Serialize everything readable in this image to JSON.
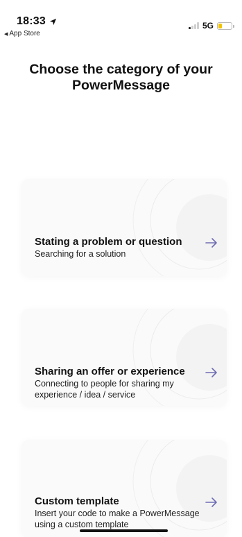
{
  "status_bar": {
    "time": "18:33",
    "back_app": "App Store",
    "network": "5G"
  },
  "title": "Choose the category of your PowerMessage",
  "cards": [
    {
      "title": "Stating a problem or question",
      "subtitle": "Searching for a solution"
    },
    {
      "title": "Sharing an offer or experience",
      "subtitle": "Connecting to people for sharing my experience / idea / service"
    },
    {
      "title": "Custom template",
      "subtitle": "Insert your code to make a PowerMessage using a custom template"
    }
  ],
  "colors": {
    "accent_arrow": "#6f6db3",
    "battery": "#f2c300"
  },
  "icons": [
    "location-arrow-icon",
    "back-triangle-icon",
    "signal-icon",
    "battery-icon",
    "arrow-right-icon"
  ]
}
